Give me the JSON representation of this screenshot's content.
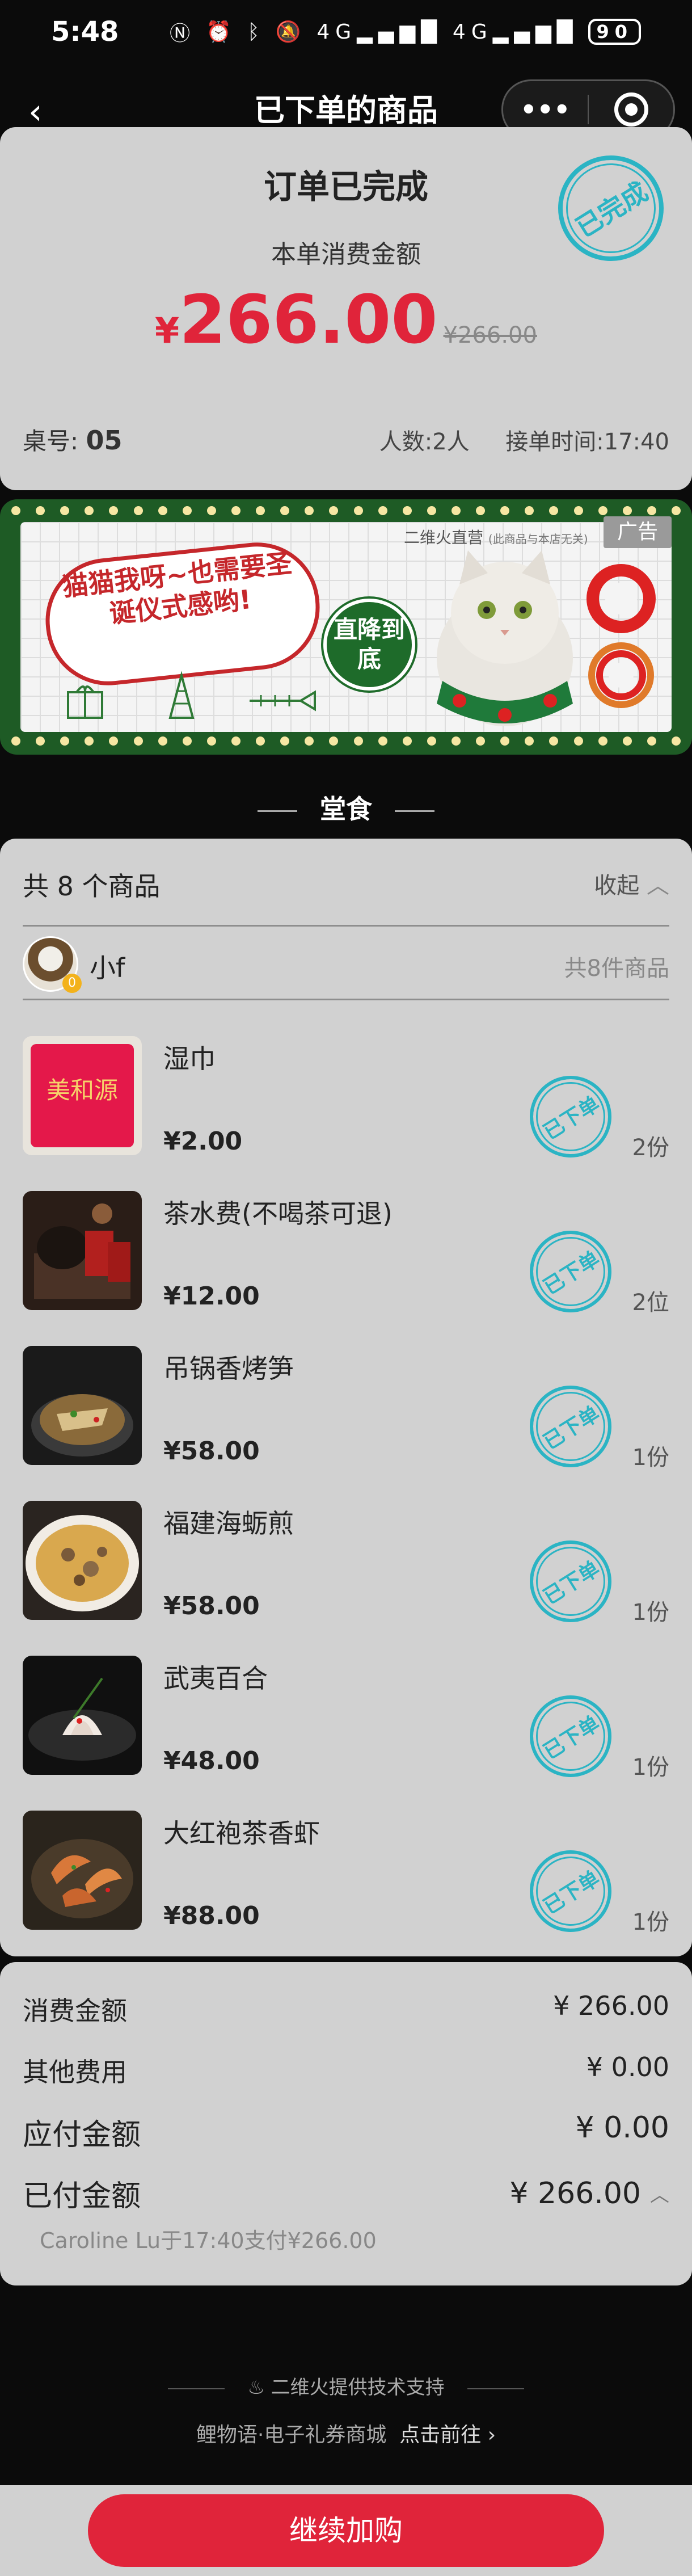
{
  "status_bar": {
    "time": "5:48",
    "icons": [
      "nfc-icon",
      "alarm-icon",
      "bluetooth-icon",
      "mute-icon",
      "signal-4g-icon",
      "signal-4g-icon"
    ],
    "battery": "90"
  },
  "nav": {
    "title": "已下单的商品",
    "more_label": "•••"
  },
  "order": {
    "status_title": "订单已完成",
    "amount_label": "本单消费金额",
    "currency": "¥",
    "amount": "266.00",
    "original_amount": "¥266.00",
    "stamp": "已完成",
    "table_label": "桌号:",
    "table_no": "05",
    "people": "人数:2人",
    "order_time": "接单时间:17:40"
  },
  "ad": {
    "brand": "二维火直营",
    "brand_note": "(此商品与本店无关)",
    "tag": "广告",
    "headline": "猫猫我呀~也需要圣诞仪式感哟!",
    "badge": "直降到底"
  },
  "section": {
    "label": "堂食"
  },
  "items_card": {
    "count_title": "共 8 个商品",
    "collapse_label": "收起",
    "user": {
      "name": "小f",
      "badge": "0",
      "total": "共8件商品"
    },
    "stamp_label": "已下单",
    "items": [
      {
        "name": "湿巾",
        "price": "¥2.00",
        "qty": "2份",
        "thumb": "towel"
      },
      {
        "name": "茶水费(不喝茶可退)",
        "price": "¥12.00",
        "qty": "2位",
        "thumb": "tea"
      },
      {
        "name": "吊锅香烤笋",
        "price": "¥58.00",
        "qty": "1份",
        "thumb": "bamboo"
      },
      {
        "name": "福建海蛎煎",
        "price": "¥58.00",
        "qty": "1份",
        "thumb": "oyster"
      },
      {
        "name": "武夷百合",
        "price": "¥48.00",
        "qty": "1份",
        "thumb": "lily"
      },
      {
        "name": "大红袍茶香虾",
        "price": "¥88.00",
        "qty": "1份",
        "thumb": "shrimp"
      }
    ]
  },
  "totals": {
    "consume_label": "消费金额",
    "consume_value": "¥ 266.00",
    "other_label": "其他费用",
    "other_value": "¥ 0.00",
    "payable_label": "应付金额",
    "payable_value": "¥ 0.00",
    "paid_label": "已付金额",
    "paid_value": "¥ 266.00",
    "pay_note": "Caroline Lu于17:40支付¥266.00"
  },
  "footer": {
    "powered_by": "二维火提供技术支持",
    "promo_text": "鲤物语·电子礼券商城",
    "promo_link": "点击前往 ›",
    "continue_button": "继续加购"
  },
  "colors": {
    "accent_red": "#e0243a",
    "stamp_teal": "#2bb4c4",
    "card_gray": "#d1d1d1",
    "ad_green": "#1e5b25"
  }
}
